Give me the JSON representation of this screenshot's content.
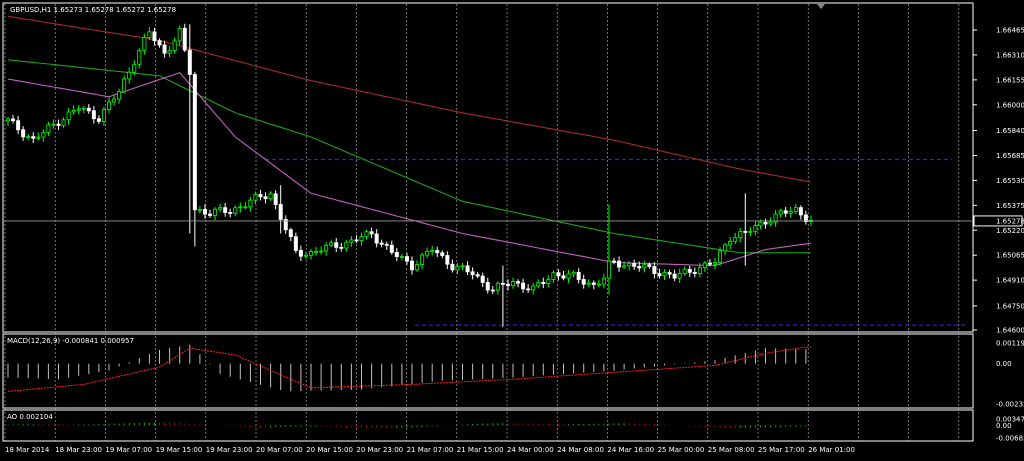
{
  "main": {
    "symbol_label": "GBPUSD,H1  1.65273 1.65278 1.65272 1.65278",
    "current_price_label": "1.65278",
    "current_price": 1.65278,
    "price_ticks": [
      "1.66465",
      "1.66310",
      "1.66155",
      "1.66000",
      "1.65840",
      "1.65685",
      "1.65530",
      "1.65375",
      "1.65220",
      "1.65065",
      "1.64910",
      "1.64750",
      "1.64600"
    ],
    "levels": {
      "upper_dashed": 1.6566,
      "lower_dashed": 1.6463
    },
    "colors": {
      "bg": "#000000",
      "grid": "#ffffff",
      "bull": "#00ff00",
      "bear": "#ffffff",
      "ma_red": "#a52a2a",
      "ma_green": "#1aa31a",
      "ma_violet": "#c060c0",
      "level": "#2020ff",
      "price_line": "#999999"
    }
  },
  "macd": {
    "label": "MACD(12,26,9) -0.000841 0.000957",
    "ticks": [
      "0.001196",
      "0.00",
      "-0.002332"
    ],
    "colors": {
      "hist": "#c0c0c0",
      "signal": "#ff2020"
    }
  },
  "ao": {
    "label": "AO 0.002104",
    "ticks": [
      "0.003473",
      "0.00",
      "-0.006835"
    ],
    "colors": {
      "up": "#00c000",
      "down": "#c00000"
    }
  },
  "time_labels": [
    "18 Mar 2014",
    "18 Mar 23:00",
    "19 Mar 07:00",
    "19 Mar 15:00",
    "19 Mar 23:00",
    "20 Mar 07:00",
    "20 Mar 15:00",
    "20 Mar 23:00",
    "21 Mar 07:00",
    "21 Mar 15:00",
    "24 Mar 00:00",
    "24 Mar 08:00",
    "24 Mar 16:00",
    "25 Mar 00:00",
    "25 Mar 08:00",
    "25 Mar 17:00",
    "26 Mar 01:00"
  ],
  "chart_data": {
    "type": "candlestick",
    "timeframe": "H1",
    "symbol": "GBPUSD",
    "ohlc_last": {
      "open": 1.65273,
      "high": 1.65278,
      "low": 1.65272,
      "close": 1.65278
    },
    "anchors": [
      [
        0,
        1.659
      ],
      [
        5,
        1.6578
      ],
      [
        10,
        1.659
      ],
      [
        14,
        1.6598
      ],
      [
        18,
        1.6592
      ],
      [
        22,
        1.6608
      ],
      [
        25,
        1.6628
      ],
      [
        28,
        1.6645
      ],
      [
        31,
        1.6632
      ],
      [
        34,
        1.6645
      ],
      [
        36,
        1.662
      ],
      [
        37,
        1.6535
      ],
      [
        40,
        1.6533
      ],
      [
        44,
        1.6534
      ],
      [
        48,
        1.654
      ],
      [
        52,
        1.6545
      ],
      [
        54,
        1.653
      ],
      [
        57,
        1.6508
      ],
      [
        60,
        1.6508
      ],
      [
        64,
        1.6512
      ],
      [
        68,
        1.6515
      ],
      [
        72,
        1.652
      ],
      [
        76,
        1.6508
      ],
      [
        80,
        1.65
      ],
      [
        84,
        1.651
      ],
      [
        88,
        1.65
      ],
      [
        92,
        1.6495
      ],
      [
        96,
        1.6485
      ],
      [
        100,
        1.649
      ],
      [
        104,
        1.6485
      ],
      [
        108,
        1.6495
      ],
      [
        112,
        1.6493
      ],
      [
        116,
        1.6488
      ],
      [
        118,
        1.6492
      ],
      [
        119,
        1.65
      ],
      [
        120,
        1.6502
      ],
      [
        124,
        1.65
      ],
      [
        128,
        1.6497
      ],
      [
        132,
        1.6493
      ],
      [
        136,
        1.6498
      ],
      [
        140,
        1.6502
      ],
      [
        143,
        1.6518
      ],
      [
        146,
        1.652
      ],
      [
        150,
        1.6528
      ],
      [
        153,
        1.6532
      ],
      [
        156,
        1.6535
      ],
      [
        158,
        1.653
      ],
      [
        159,
        1.65278
      ]
    ],
    "ma_red": [
      [
        0,
        1.6655
      ],
      [
        30,
        1.664
      ],
      [
        60,
        1.6615
      ],
      [
        90,
        1.6595
      ],
      [
        120,
        1.6578
      ],
      [
        145,
        1.656
      ],
      [
        159,
        1.6552
      ]
    ],
    "ma_green": [
      [
        0,
        1.6628
      ],
      [
        30,
        1.6618
      ],
      [
        45,
        1.6595
      ],
      [
        60,
        1.658
      ],
      [
        90,
        1.654
      ],
      [
        120,
        1.652
      ],
      [
        145,
        1.6508
      ],
      [
        159,
        1.6508
      ]
    ],
    "ma_violet": [
      [
        0,
        1.6616
      ],
      [
        20,
        1.6605
      ],
      [
        34,
        1.662
      ],
      [
        45,
        1.658
      ],
      [
        60,
        1.6545
      ],
      [
        90,
        1.652
      ],
      [
        120,
        1.6502
      ],
      [
        140,
        1.65
      ],
      [
        150,
        1.651
      ],
      [
        159,
        1.6514
      ]
    ]
  }
}
